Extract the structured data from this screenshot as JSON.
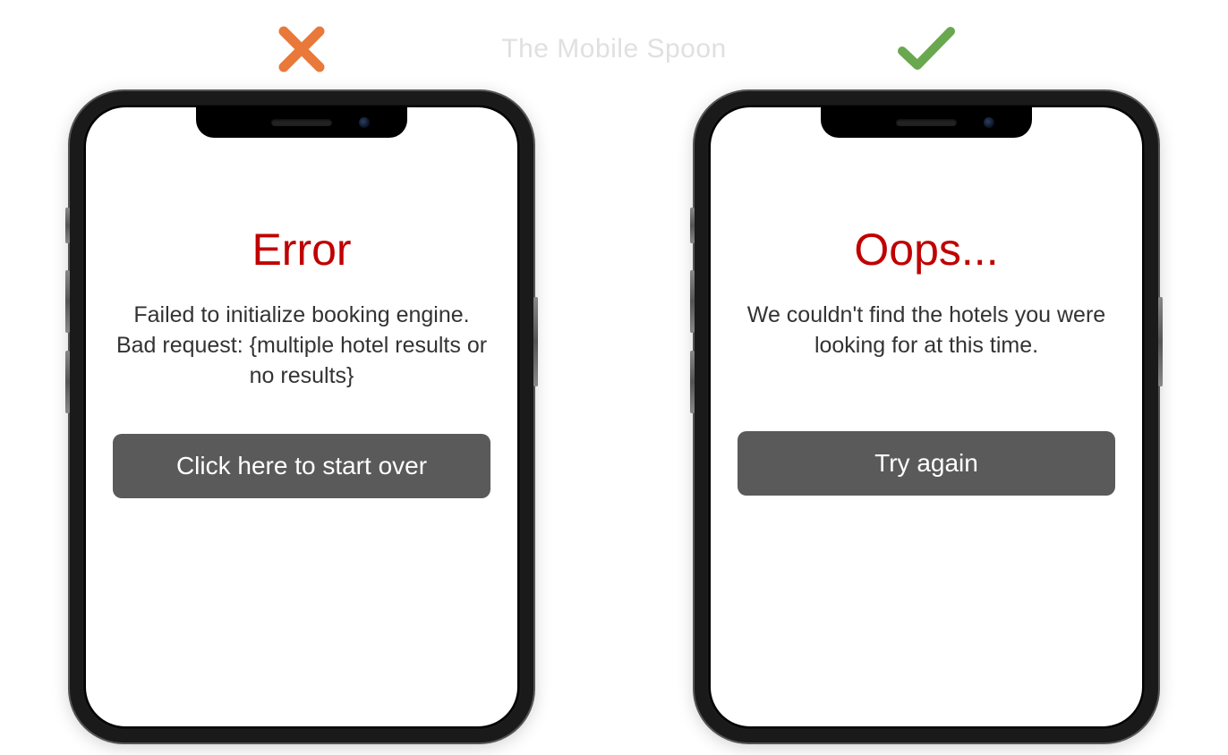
{
  "watermark": "The Mobile Spoon",
  "bad": {
    "title": "Error",
    "body": "Failed to initialize booking engine. Bad request: {multiple hotel results or no results}",
    "button": "Click here to start over"
  },
  "good": {
    "title": "Oops...",
    "body": "We couldn't find the hotels you were looking for at this time.",
    "button": "Try again"
  },
  "icons": {
    "cross_color": "#e8793a",
    "check_color": "#6aa84f"
  }
}
